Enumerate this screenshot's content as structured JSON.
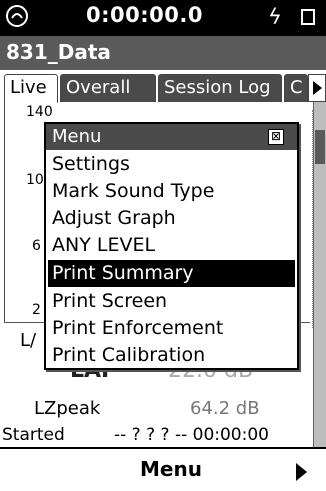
{
  "status": {
    "timer": "0:00:00.0",
    "status_icon": "sensor-icon",
    "flash_icon": "lightning-icon",
    "battery_icon": "battery-icon"
  },
  "title": "831_Data",
  "tabs": [
    {
      "label": "Live",
      "active": true
    },
    {
      "label": "Overall",
      "active": false
    },
    {
      "label": "Session Log",
      "active": false
    },
    {
      "label": "C",
      "active": false
    }
  ],
  "chart": {
    "y_labels": [
      "140",
      "10",
      "6",
      "2"
    ]
  },
  "readouts": {
    "la_label": "L/",
    "big_label": "LAF",
    "big_value": "22.0 dB",
    "peak_label": "LZpeak",
    "peak_value": "64.2 dB",
    "started_label": "Started",
    "started_value": "-- ? ? ? -- 00:00:00"
  },
  "menu": {
    "title": "Menu",
    "close_glyph": "⊠",
    "items": [
      {
        "label": "Settings"
      },
      {
        "label": "Mark Sound Type"
      },
      {
        "label": "Adjust Graph"
      },
      {
        "label": "ANY LEVEL"
      },
      {
        "label": "Print Summary",
        "selected": true
      },
      {
        "label": "Print Screen"
      },
      {
        "label": "Print Enforcement"
      },
      {
        "label": "Print Calibration"
      }
    ]
  },
  "bottom": {
    "softkey_label": "Menu"
  },
  "colors": {
    "status_bar": "#000000",
    "title_bar": "#5a5a5a",
    "selection": "#000000"
  }
}
